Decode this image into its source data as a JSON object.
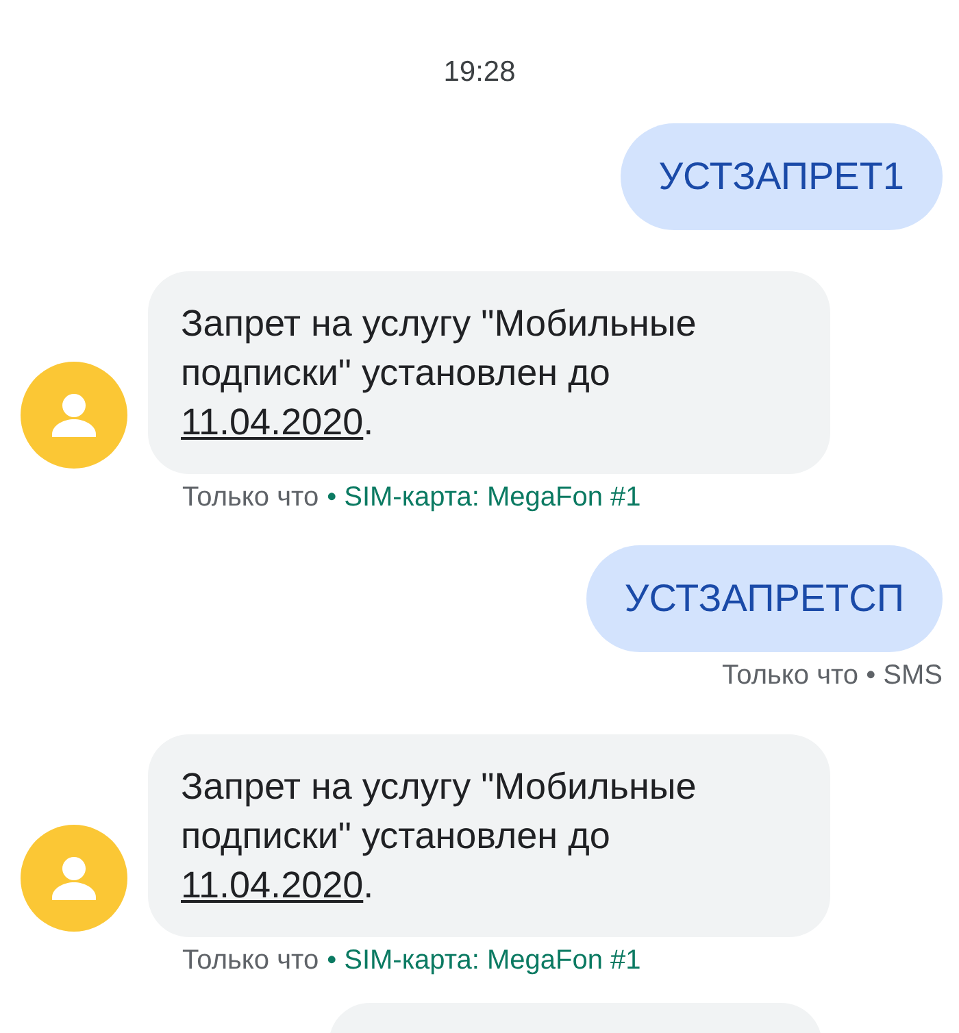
{
  "timestamp": "19:28",
  "messages": [
    {
      "kind": "outgoing",
      "text": "УСТЗАПРЕТ1"
    },
    {
      "kind": "incoming",
      "text": "Запрет на услугу \"Мобильные подписки\" установлен до",
      "link": "11.04.2020",
      "after": ".",
      "meta_time": "Только что",
      "sim": "• SIM-карта: MegaFon #1"
    },
    {
      "kind": "outgoing",
      "text": "УСТЗАПРЕТСП",
      "meta": "Только что • SMS"
    },
    {
      "kind": "incoming",
      "text": "Запрет на услугу \"Мобильные подписки\" установлен до",
      "link": "11.04.2020",
      "after": ".",
      "meta_time": "Только что",
      "sim": "• SIM-карта: MegaFon #1"
    },
    {
      "kind": "partial"
    }
  ]
}
